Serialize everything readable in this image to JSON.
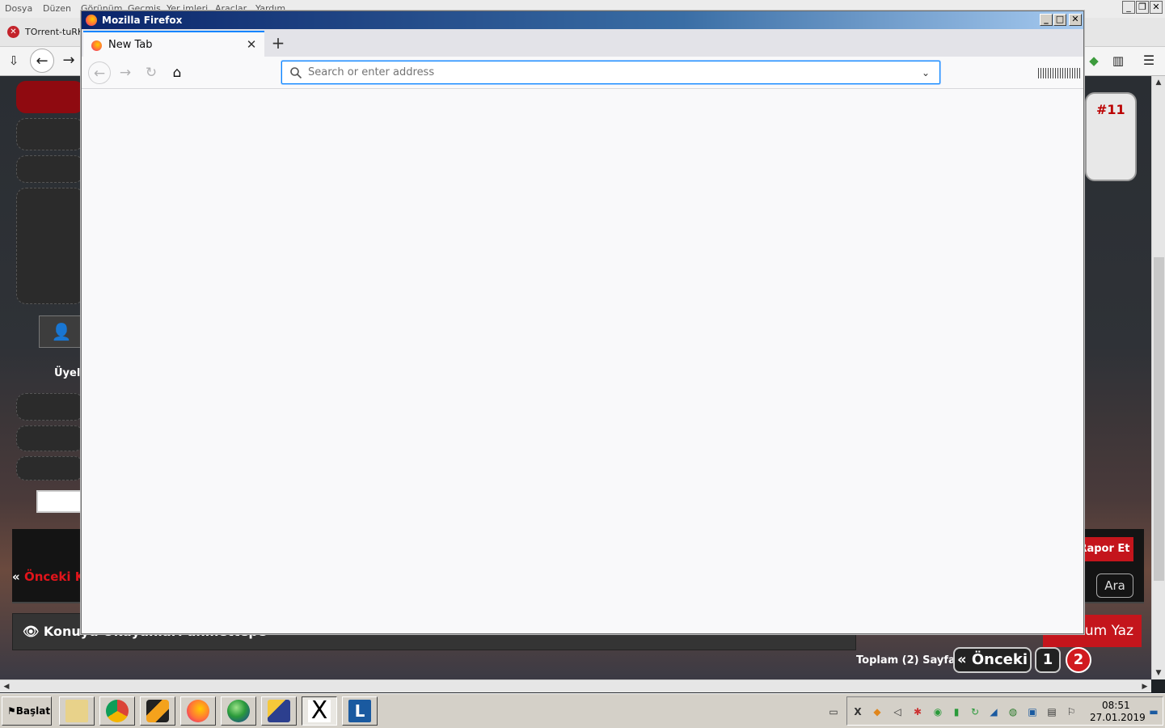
{
  "background_browser": {
    "menu": [
      "Dosya",
      "Düzen",
      "Görünüm",
      "Geçmiş",
      "Yer imleri",
      "Araçlar",
      "Yardım"
    ],
    "tab_label": "TOrrent-tuRK",
    "page": {
      "uyeli_label": "Üyeli",
      "onceki_prefix": "«",
      "onceki_label": "Önceki K",
      "konuyu_text": "Konuyu Okuyanlar: ahmettepe",
      "post_number": "#11",
      "rapor_button": "Rapor Et",
      "ara_button": "Ara",
      "yorum_button": "Yorum Yaz",
      "pagination": {
        "label": "Toplam (2) Sayfa:",
        "prev": "« Önceki",
        "pages": [
          "1",
          "2"
        ],
        "current": "2"
      }
    }
  },
  "firefox": {
    "window_title": "Mozilla Firefox",
    "tab": {
      "label": "New Tab",
      "close": "✕"
    },
    "new_tab_glyph": "+",
    "urlbar": {
      "placeholder": "Search or enter address",
      "value": ""
    },
    "nav_glyphs": {
      "back": "←",
      "forward": "→",
      "reload": "↻",
      "home": "⌂"
    },
    "accent": "#0a84ff"
  },
  "taskbar": {
    "start_label": "Başlat",
    "apps": [
      "file-manager",
      "chrome",
      "pencil-tool",
      "firefox",
      "globe-app",
      "network-app",
      "x-app",
      "l-app"
    ],
    "active_app": "x-app",
    "clock": {
      "time": "08:51",
      "date": "27.01.2019"
    }
  }
}
